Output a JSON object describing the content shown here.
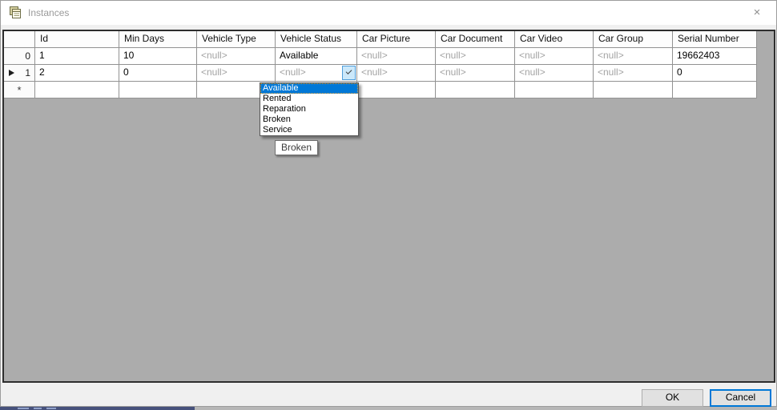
{
  "window": {
    "title": "Instances",
    "close_glyph": "×"
  },
  "grid": {
    "columns": [
      "Id",
      "Min Days",
      "Vehicle Type",
      "Vehicle Status",
      "Car Picture",
      "Car Document",
      "Car Video",
      "Car Group",
      "Serial Number"
    ],
    "rows": [
      {
        "header": "0",
        "current": false,
        "new_row": false,
        "cells": [
          "1",
          "10",
          "<null>",
          "Available",
          "<null>",
          "<null>",
          "<null>",
          "<null>",
          "19662403"
        ]
      },
      {
        "header": "1",
        "current": true,
        "new_row": false,
        "cells": [
          "2",
          "0",
          "<null>",
          "<null>",
          "<null>",
          "<null>",
          "<null>",
          "<null>",
          "0"
        ]
      },
      {
        "header": "*",
        "current": false,
        "new_row": true,
        "cells": [
          "",
          "",
          "",
          "",
          "",
          "",
          "",
          "",
          ""
        ]
      }
    ],
    "null_display": "<null>",
    "editing": {
      "row_index": 1,
      "column_index": 3
    }
  },
  "dropdown": {
    "items": [
      "Available",
      "Rented",
      "Reparation",
      "Broken",
      "Service"
    ],
    "highlighted_index": 0
  },
  "tooltip": {
    "text": "Broken"
  },
  "footer": {
    "ok_label": "OK",
    "cancel_label": "Cancel"
  },
  "icons": {
    "new_row_glyph": "*"
  },
  "colors": {
    "accent": "#0078d7",
    "selection_blue": "#0078d7",
    "grid_background": "#acacac",
    "combo_button_fill": "#cbe8fa"
  }
}
